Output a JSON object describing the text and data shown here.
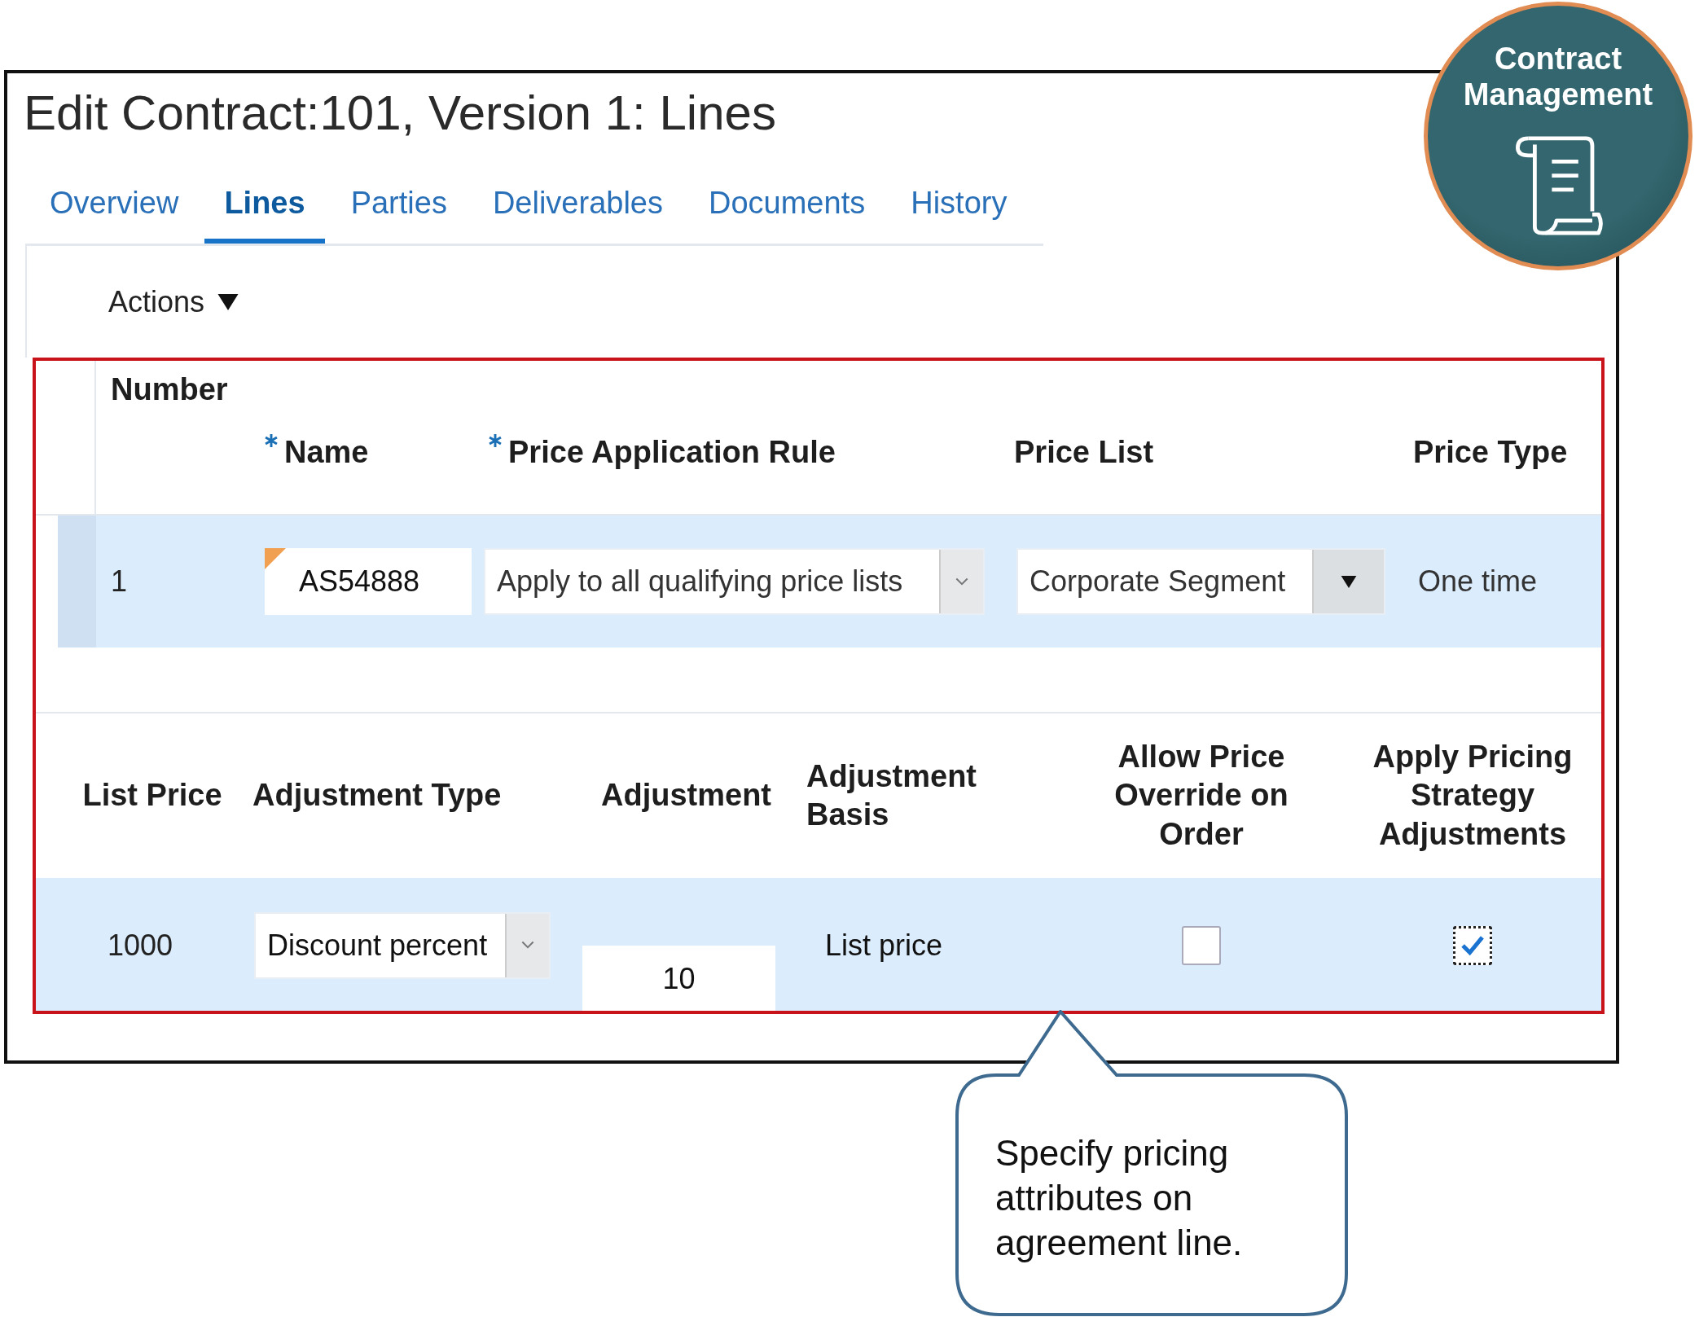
{
  "page": {
    "title": "Edit Contract:101, Version 1: Lines"
  },
  "badge": {
    "title": "Contract Management"
  },
  "tabs": [
    {
      "label": "Overview",
      "selected": false
    },
    {
      "label": "Lines",
      "selected": true
    },
    {
      "label": "Parties",
      "selected": false
    },
    {
      "label": "Deliverables",
      "selected": false
    },
    {
      "label": "Documents",
      "selected": false
    },
    {
      "label": "History",
      "selected": false
    }
  ],
  "actions_menu": {
    "label": "Actions"
  },
  "lines_table": {
    "columns": [
      {
        "label": "Number",
        "required": false
      },
      {
        "label": "Name",
        "required": true
      },
      {
        "label": "Price Application Rule",
        "required": true
      },
      {
        "label": "Price List",
        "required": false
      },
      {
        "label": "Price Type",
        "required": false
      }
    ],
    "rows": [
      {
        "number": "1",
        "name": "AS54888",
        "changed": true,
        "price_application_rule": "Apply to all qualifying price lists",
        "price_list": "Corporate Segment",
        "price_type": "One time"
      }
    ]
  },
  "pricing_table": {
    "columns": [
      "List Price",
      "Adjustment Type",
      "Adjustment",
      "Adjustment Basis",
      "Allow Price Override on Order",
      "Apply Pricing Strategy Adjustments"
    ],
    "rows": [
      {
        "list_price": "1000",
        "adjustment_type": "Discount percent",
        "adjustment": "10",
        "adjustment_basis": "List price",
        "allow_price_override": false,
        "apply_pricing_strategy": true
      }
    ]
  },
  "callout": {
    "text": "Specify pricing attributes on agreement line."
  }
}
